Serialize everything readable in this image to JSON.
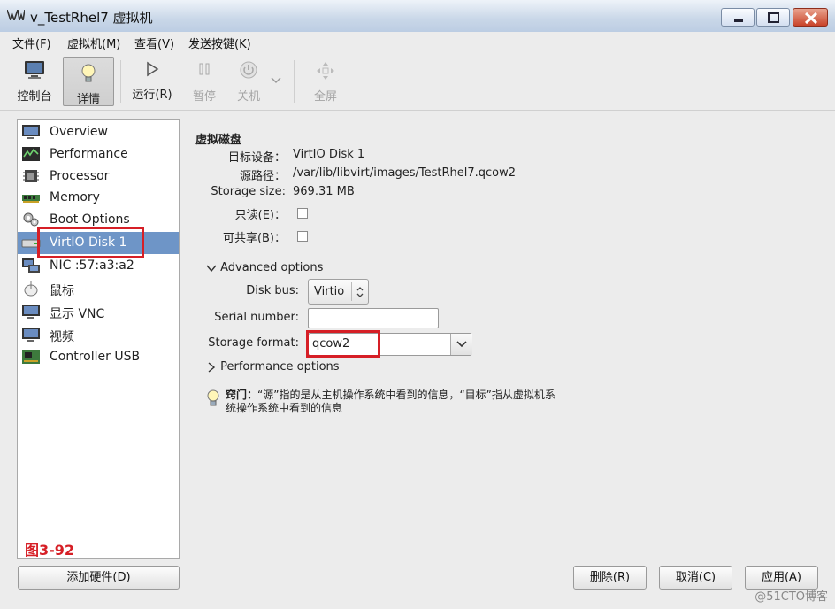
{
  "window": {
    "title": "v_TestRhel7 虚拟机"
  },
  "menubar": {
    "items": [
      "文件(F)",
      "虚拟机(M)",
      "查看(V)",
      "发送按键(K)"
    ]
  },
  "toolbar": {
    "console": "控制台",
    "details": "详情",
    "run": "运行(R)",
    "pause": "暂停",
    "shutdown": "关机",
    "fullscreen": "全屏"
  },
  "sidebar": {
    "items": [
      {
        "label": "Overview",
        "icon": "monitor-icon"
      },
      {
        "label": "Performance",
        "icon": "performance-icon"
      },
      {
        "label": "Processor",
        "icon": "cpu-icon"
      },
      {
        "label": "Memory",
        "icon": "memory-icon"
      },
      {
        "label": "Boot Options",
        "icon": "boot-options-icon"
      },
      {
        "label": "VirtIO Disk 1",
        "icon": "disk-icon",
        "selected": true
      },
      {
        "label": "NIC :57:a3:a2",
        "icon": "nic-icon"
      },
      {
        "label": "鼠标",
        "icon": "mouse-icon"
      },
      {
        "label": "显示 VNC",
        "icon": "display-icon"
      },
      {
        "label": "视频",
        "icon": "video-icon"
      },
      {
        "label": "Controller USB",
        "icon": "usb-controller-icon"
      }
    ],
    "figure_label": "图3-92"
  },
  "details": {
    "section_title": "虚拟磁盘",
    "target_device_label": "目标设备：",
    "target_device_value": "VirtIO Disk 1",
    "source_path_label": "源路径：",
    "source_path_value": "/var/lib/libvirt/images/TestRhel7.qcow2",
    "storage_size_label": "Storage size:",
    "storage_size_value": "969.31 MB",
    "readonly_label": "只读(E)：",
    "shareable_label": "可共享(B)：",
    "advanced_label": "Advanced options",
    "disk_bus_label": "Disk bus:",
    "disk_bus_value": "Virtio",
    "serial_label": "Serial number:",
    "serial_value": "",
    "storage_format_label": "Storage format:",
    "storage_format_value": "qcow2",
    "performance_label": "Performance options",
    "hint_bold": "窍门：",
    "hint_text": "“源”指的是从主机操作系统中看到的信息，“目标”指从虚拟机系统操作系统中看到的信息"
  },
  "buttons": {
    "add_hardware": "添加硬件(D)",
    "remove": "删除(R)",
    "cancel": "取消(C)",
    "apply": "应用(A)"
  },
  "watermark": "@51CTO博客",
  "colors": {
    "selection": "#6e95c7",
    "highlight": "#d61f26"
  }
}
